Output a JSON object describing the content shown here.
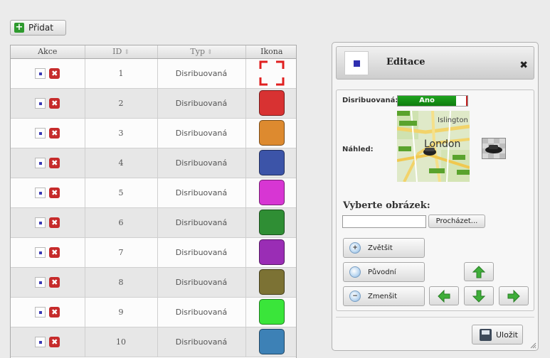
{
  "toolbar": {
    "add_label": "Přidat"
  },
  "table": {
    "columns": [
      {
        "label": "Akce",
        "sortable": false
      },
      {
        "label": "ID",
        "sortable": true
      },
      {
        "label": "Typ",
        "sortable": true
      },
      {
        "label": "Ikona",
        "sortable": false
      }
    ],
    "sort_glyph": "⇕",
    "delete_glyph": "✖",
    "rows": [
      {
        "id": "1",
        "typ": "Disribuovaná",
        "icon_color": null
      },
      {
        "id": "2",
        "typ": "Disribuovaná",
        "icon_color": "#d83232"
      },
      {
        "id": "3",
        "typ": "Disribuovaná",
        "icon_color": "#dd8a2f"
      },
      {
        "id": "4",
        "typ": "Disribuovaná",
        "icon_color": "#3c54a8"
      },
      {
        "id": "5",
        "typ": "Disribuovaná",
        "icon_color": "#d736d3"
      },
      {
        "id": "6",
        "typ": "Disribuovaná",
        "icon_color": "#2f8e34"
      },
      {
        "id": "7",
        "typ": "Disribuovaná",
        "icon_color": "#9a2db5"
      },
      {
        "id": "8",
        "typ": "Disribuovaná",
        "icon_color": "#7c7234"
      },
      {
        "id": "9",
        "typ": "Disribuovaná",
        "icon_color": "#3ae53a"
      },
      {
        "id": "10",
        "typ": "Disribuovaná",
        "icon_color": "#3d81b6"
      }
    ],
    "dashed_icon_color": "#e02020"
  },
  "editor": {
    "title": "Editace",
    "close_glyph": "✖",
    "distributed_label": "Disribuovaná:",
    "distributed_value": "Ano",
    "preview_label": "Náhled:",
    "map": {
      "big_label": "London",
      "small_label": "Islington"
    },
    "upload_title": "Vyberte obrázek:",
    "file_value": "",
    "browse_label": "Procházet...",
    "zoom_in_label": "Zvětšit",
    "original_label": "Původní",
    "zoom_out_label": "Zmenšit",
    "zoom_in_glyph": "+",
    "zoom_out_glyph": "−",
    "save_label": "Uložit"
  },
  "colors": {
    "toggle_on": "#179317",
    "arrow_green": "#3fae3a"
  }
}
